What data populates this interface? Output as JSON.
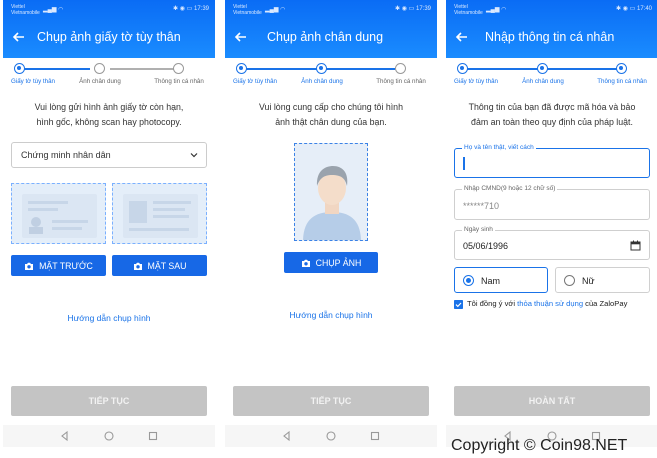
{
  "status_bar": {
    "carrier_line1": "Viettel",
    "carrier_line2": "Vietnamobile",
    "time_1": "17:39",
    "time_2": "17:39",
    "time_3": "17:40"
  },
  "steps": [
    "Giấy tờ tùy thân",
    "Ảnh chân dung",
    "Thông tin cá nhân"
  ],
  "screen1": {
    "title": "Chụp ảnh giấy tờ tùy thân",
    "desc_line1": "Vui lòng gửi hình ảnh giấy tờ còn hạn,",
    "desc_line2": "hình gốc, không scan hay photocopy.",
    "doc_type": "Chứng minh nhân dân",
    "front_button": "MẶT TRƯỚC",
    "back_button": "MẶT SAU",
    "guide_link": "Hướng dẫn chụp hình",
    "continue_button": "TIẾP TỤC"
  },
  "screen2": {
    "title": "Chụp ảnh chân dung",
    "desc_line1": "Vui lòng cung cấp cho chúng tôi hình",
    "desc_line2": "ảnh thật chân dung của bạn.",
    "capture_button": "CHỤP ẢNH",
    "guide_link": "Hướng dẫn chụp hình",
    "continue_button": "TIẾP TỤC"
  },
  "screen3": {
    "title": "Nhập thông tin cá nhân",
    "desc_line1": "Thông tin của bạn đã được mã hóa và bảo",
    "desc_line2": "đảm an toàn theo quy định của pháp luật.",
    "name_label": "Họ và tên thật, viết cách",
    "id_label": "Nhập CMND(9 hoặc 12 chữ số)",
    "id_value": "******710",
    "dob_label": "Ngày sinh",
    "dob_value": "05/06/1996",
    "gender_male": "Nam",
    "gender_female": "Nữ",
    "agree_prefix": "Tôi đồng ý với ",
    "agree_link": "thỏa thuận sử dụng",
    "agree_suffix": " của ZaloPay",
    "finish_button": "HOÀN TẤT"
  },
  "watermark": "Copyright © Coin98.NET",
  "colors": {
    "primary": "#1768e6",
    "appbar": "#1a8cff",
    "disabled": "#c4c4c4"
  }
}
